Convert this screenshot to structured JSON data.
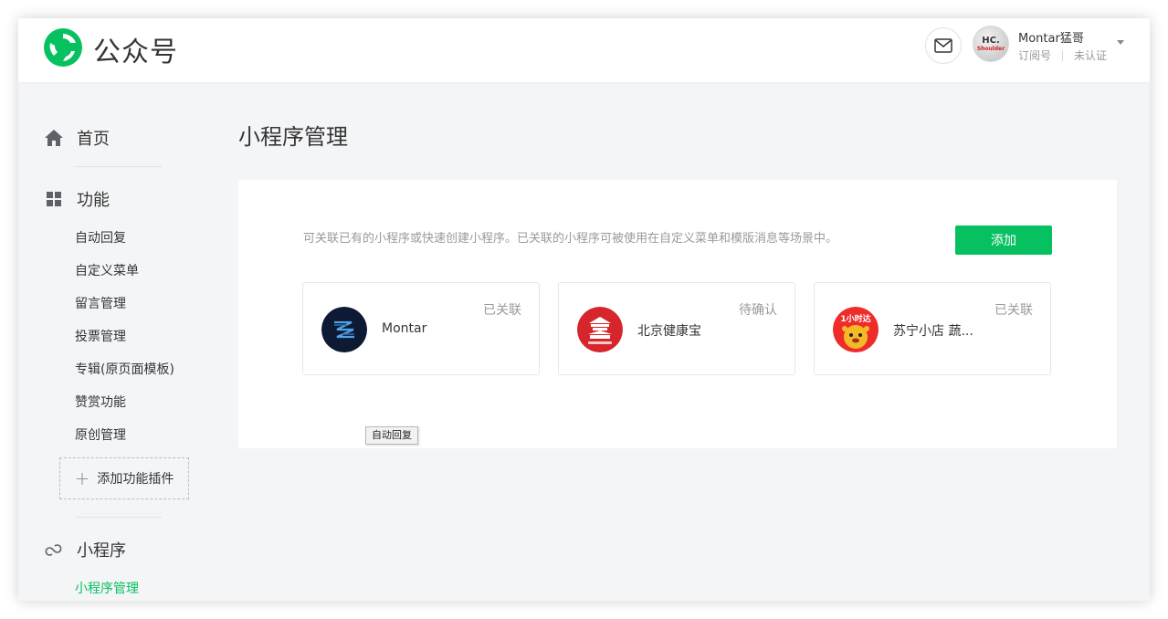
{
  "header": {
    "brand": "公众号",
    "user_name": "Montar猛哥",
    "account_type": "订阅号",
    "verify_status": "未认证",
    "avatar_text_main": "HC.",
    "avatar_text_sub": "Shoulder"
  },
  "sidebar": {
    "home": "首页",
    "features": "功能",
    "feature_items": [
      "自动回复",
      "自定义菜单",
      "留言管理",
      "投票管理",
      "专辑(原页面模板)",
      "赞赏功能",
      "原创管理"
    ],
    "add_plugin": "添加功能插件",
    "miniprogram": "小程序",
    "miniprogram_items": [
      "小程序管理"
    ]
  },
  "main": {
    "title": "小程序管理",
    "description": "可关联已有的小程序或快速创建小程序。已关联的小程序可被使用在自定义菜单和模版消息等场景中。",
    "add_button": "添加",
    "cards": [
      {
        "name": "Montar",
        "status": "已关联"
      },
      {
        "name": "北京健康宝",
        "status": "待确认"
      },
      {
        "name": "苏宁小店 蔬...",
        "status": "已关联",
        "icon_text": "1小时达"
      }
    ]
  },
  "tooltip": "自动回复",
  "colors": {
    "accent": "#07c160",
    "background": "#f4f5f7",
    "text": "#353535",
    "muted": "#9a9a9a"
  }
}
